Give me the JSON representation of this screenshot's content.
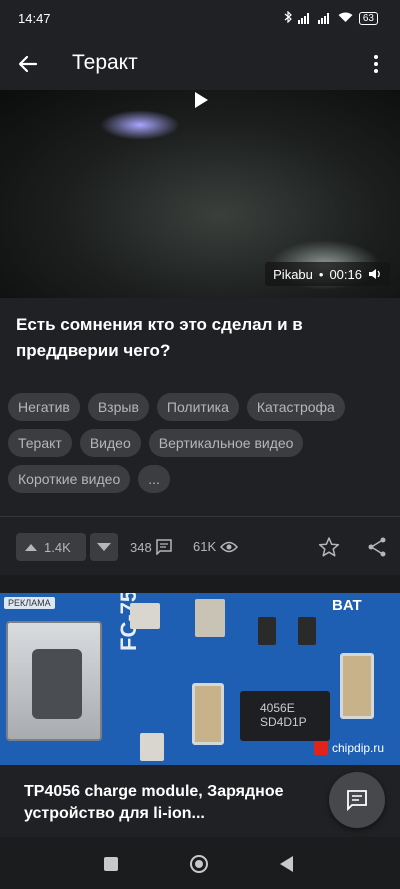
{
  "status_bar": {
    "time": "14:47",
    "battery": "63"
  },
  "app_bar": {
    "title": "Теракт"
  },
  "video": {
    "source": "Pikabu",
    "separator": "•",
    "duration": "00:16"
  },
  "post": {
    "title": "Есть сомнения кто это сделал и в преддверии чего?",
    "tags": [
      "Негатив",
      "Взрыв",
      "Политика",
      "Катастрофа",
      "Теракт",
      "Видео",
      "Вертикальное видео",
      "Короткие видео",
      "..."
    ]
  },
  "actions": {
    "rating": "1.4K",
    "comments": "348",
    "views": "61K"
  },
  "ad": {
    "label": "РЕКЛАМА",
    "image_texts": {
      "board": "FC-75.",
      "chip_line1": "4056E",
      "chip_line2": "SD4D1P",
      "bat": "BAT",
      "brand": "chipdip.ru"
    },
    "title": "TP4056 charge module, Зарядное устройство для li-ion..."
  },
  "colors": {
    "background": "#202124",
    "tag_bg": "#3c3d40",
    "ad_board": "#1e5fb4"
  },
  "icons": [
    "arrow-back-icon",
    "more-vert-icon",
    "play-icon",
    "volume-icon",
    "arrow-up-icon",
    "arrow-down-icon",
    "comment-icon",
    "eye-icon",
    "star-icon",
    "share-icon",
    "chat-icon"
  ]
}
